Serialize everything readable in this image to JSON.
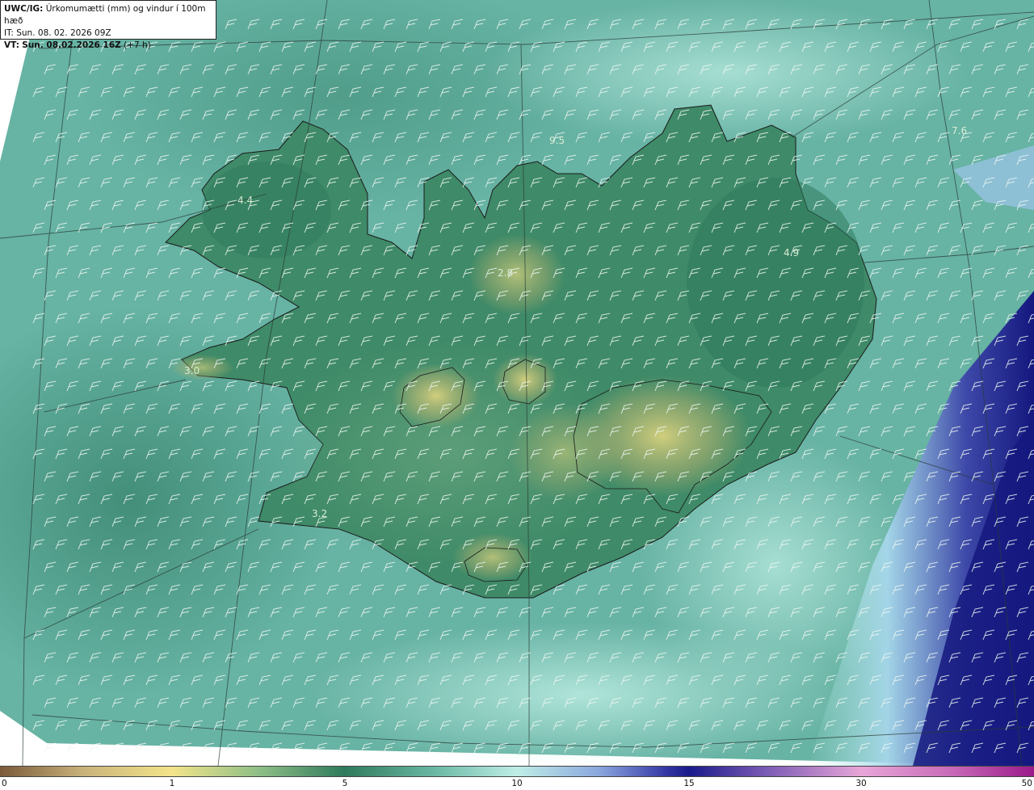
{
  "header": {
    "product_code": "UWC/IG:",
    "product_title": "Úrkomumætti (mm) og vindur í 100m hæð",
    "initial_time": "IT: Sun. 08. 02. 2026 09Z",
    "valid_label": "VT:",
    "valid_time": "Sun. 08.02.2026 16Z",
    "lead_time": "(+7 h)"
  },
  "map_values": [
    {
      "text": "9.5",
      "id": "value-9-5-north"
    },
    {
      "text": "4.4",
      "id": "value-4-4-westfjords"
    },
    {
      "text": "2.8",
      "id": "value-2-8-north-central"
    },
    {
      "text": "4.9",
      "id": "value-4-9-east"
    },
    {
      "text": "3.0",
      "id": "value-3-0-snaefellsnes"
    },
    {
      "text": "3.2",
      "id": "value-3-2-southwest"
    },
    {
      "text": "7.6",
      "id": "value-7-6-northeast-sea"
    }
  ],
  "colorbar": {
    "ticks": [
      "0",
      "1",
      "5",
      "10",
      "15",
      "30",
      "50"
    ],
    "colors": {
      "dry": "#7a5a3a",
      "low": "#f3e48a",
      "mid": "#2e7a5c",
      "moderate": "#bfeee6",
      "high": "#1a1a8a",
      "very_high": "#e8a6d8",
      "extreme": "#9a1a8a"
    }
  },
  "colors": {
    "sea_teal": "#5fb0a0",
    "sea_light": "#b9ece2",
    "land_green": "#3f8a68",
    "land_yellow": "#c9c87a",
    "heavy_precip": "#1b1f8c"
  }
}
